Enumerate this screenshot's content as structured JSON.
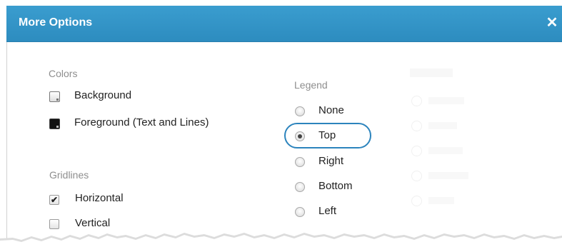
{
  "dialog": {
    "title": "More Options",
    "close_icon": "close-icon",
    "title_bar_color": "#3396c8",
    "highlight_color": "#2c84bd"
  },
  "colors": {
    "heading": "Colors",
    "items": [
      {
        "label": "Background",
        "icon": "light-swatch-icon"
      },
      {
        "label": "Foreground (Text and Lines)",
        "icon": "dark-swatch-icon"
      }
    ]
  },
  "gridlines": {
    "heading": "Gridlines",
    "items": [
      {
        "label": "Horizontal",
        "checked": true
      },
      {
        "label": "Vertical",
        "checked": false
      }
    ]
  },
  "legend": {
    "heading": "Legend",
    "selected": "Top",
    "options": [
      "None",
      "Top",
      "Right",
      "Bottom",
      "Left"
    ]
  }
}
